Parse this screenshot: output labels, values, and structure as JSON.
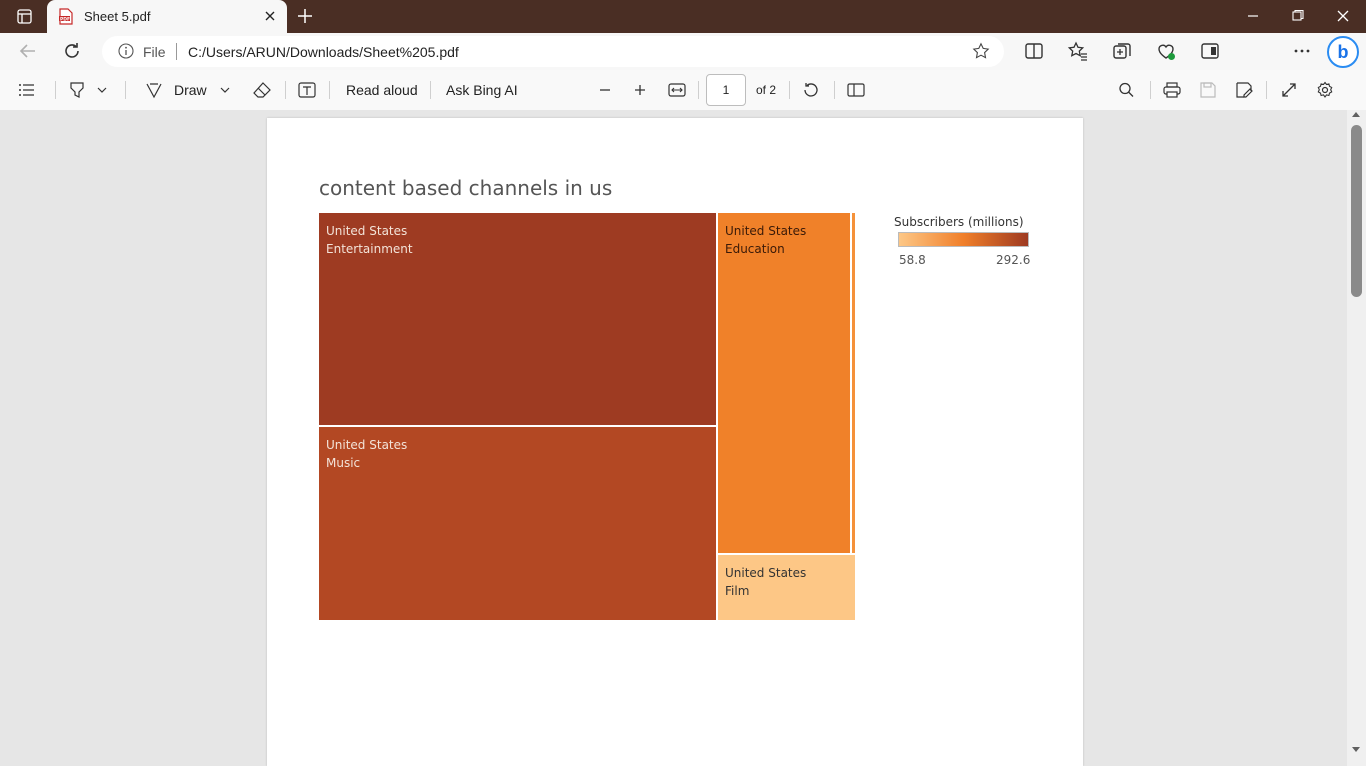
{
  "browser": {
    "tab": {
      "title": "Sheet 5.pdf"
    },
    "address": {
      "scheme_label": "File",
      "url": "C:/Users/ARUN/Downloads/Sheet%205.pdf"
    },
    "title_bar_color": "#4a2e24"
  },
  "pdf_toolbar": {
    "draw_label": "Draw",
    "read_aloud_label": "Read aloud",
    "ask_bing_label": "Ask Bing AI",
    "page_number": "1",
    "page_of": "of 2"
  },
  "chart_data": {
    "type": "treemap",
    "title": "content based channels in us",
    "legend": {
      "title": "Subscribers (millions)",
      "min_label": "58.8",
      "max_label": "292.6",
      "min": 58.8,
      "max": 292.6,
      "color_low": "#fdc786",
      "color_mid": "#f07f2a",
      "color_high": "#9e3a21"
    },
    "tiles": [
      {
        "line1": "United States",
        "line2": "Entertainment",
        "value": 292.6,
        "color": "#9e3b22"
      },
      {
        "line1": "United States",
        "line2": "Music",
        "value": 266.5,
        "color": "#b34823"
      },
      {
        "line1": "United States",
        "line2": "Education",
        "value": 150.7,
        "color": "#f08129"
      },
      {
        "line1": "United States",
        "line2": "Film",
        "value": 58.8,
        "color": "#fdc786"
      }
    ],
    "sliver_color": "#f5923a"
  }
}
